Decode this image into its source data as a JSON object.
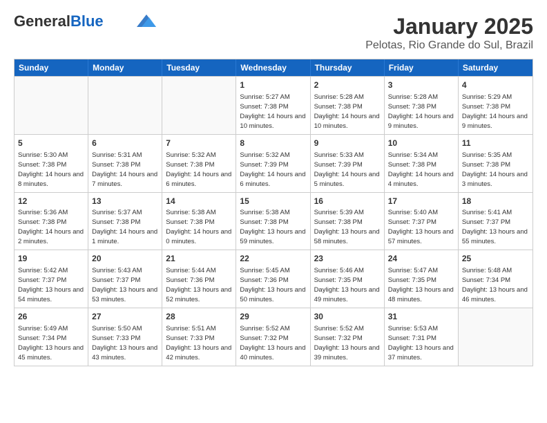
{
  "header": {
    "logo_general": "General",
    "logo_blue": "Blue",
    "title": "January 2025",
    "subtitle": "Pelotas, Rio Grande do Sul, Brazil"
  },
  "calendar": {
    "days_of_week": [
      "Sunday",
      "Monday",
      "Tuesday",
      "Wednesday",
      "Thursday",
      "Friday",
      "Saturday"
    ],
    "rows": [
      [
        {
          "day": "",
          "sunrise": "",
          "sunset": "",
          "daylight": "",
          "empty": true
        },
        {
          "day": "",
          "sunrise": "",
          "sunset": "",
          "daylight": "",
          "empty": true
        },
        {
          "day": "",
          "sunrise": "",
          "sunset": "",
          "daylight": "",
          "empty": true
        },
        {
          "day": "1",
          "sunrise": "Sunrise: 5:27 AM",
          "sunset": "Sunset: 7:38 PM",
          "daylight": "Daylight: 14 hours and 10 minutes."
        },
        {
          "day": "2",
          "sunrise": "Sunrise: 5:28 AM",
          "sunset": "Sunset: 7:38 PM",
          "daylight": "Daylight: 14 hours and 10 minutes."
        },
        {
          "day": "3",
          "sunrise": "Sunrise: 5:28 AM",
          "sunset": "Sunset: 7:38 PM",
          "daylight": "Daylight: 14 hours and 9 minutes."
        },
        {
          "day": "4",
          "sunrise": "Sunrise: 5:29 AM",
          "sunset": "Sunset: 7:38 PM",
          "daylight": "Daylight: 14 hours and 9 minutes."
        }
      ],
      [
        {
          "day": "5",
          "sunrise": "Sunrise: 5:30 AM",
          "sunset": "Sunset: 7:38 PM",
          "daylight": "Daylight: 14 hours and 8 minutes."
        },
        {
          "day": "6",
          "sunrise": "Sunrise: 5:31 AM",
          "sunset": "Sunset: 7:38 PM",
          "daylight": "Daylight: 14 hours and 7 minutes."
        },
        {
          "day": "7",
          "sunrise": "Sunrise: 5:32 AM",
          "sunset": "Sunset: 7:38 PM",
          "daylight": "Daylight: 14 hours and 6 minutes."
        },
        {
          "day": "8",
          "sunrise": "Sunrise: 5:32 AM",
          "sunset": "Sunset: 7:39 PM",
          "daylight": "Daylight: 14 hours and 6 minutes."
        },
        {
          "day": "9",
          "sunrise": "Sunrise: 5:33 AM",
          "sunset": "Sunset: 7:39 PM",
          "daylight": "Daylight: 14 hours and 5 minutes."
        },
        {
          "day": "10",
          "sunrise": "Sunrise: 5:34 AM",
          "sunset": "Sunset: 7:38 PM",
          "daylight": "Daylight: 14 hours and 4 minutes."
        },
        {
          "day": "11",
          "sunrise": "Sunrise: 5:35 AM",
          "sunset": "Sunset: 7:38 PM",
          "daylight": "Daylight: 14 hours and 3 minutes."
        }
      ],
      [
        {
          "day": "12",
          "sunrise": "Sunrise: 5:36 AM",
          "sunset": "Sunset: 7:38 PM",
          "daylight": "Daylight: 14 hours and 2 minutes."
        },
        {
          "day": "13",
          "sunrise": "Sunrise: 5:37 AM",
          "sunset": "Sunset: 7:38 PM",
          "daylight": "Daylight: 14 hours and 1 minute."
        },
        {
          "day": "14",
          "sunrise": "Sunrise: 5:38 AM",
          "sunset": "Sunset: 7:38 PM",
          "daylight": "Daylight: 14 hours and 0 minutes."
        },
        {
          "day": "15",
          "sunrise": "Sunrise: 5:38 AM",
          "sunset": "Sunset: 7:38 PM",
          "daylight": "Daylight: 13 hours and 59 minutes."
        },
        {
          "day": "16",
          "sunrise": "Sunrise: 5:39 AM",
          "sunset": "Sunset: 7:38 PM",
          "daylight": "Daylight: 13 hours and 58 minutes."
        },
        {
          "day": "17",
          "sunrise": "Sunrise: 5:40 AM",
          "sunset": "Sunset: 7:37 PM",
          "daylight": "Daylight: 13 hours and 57 minutes."
        },
        {
          "day": "18",
          "sunrise": "Sunrise: 5:41 AM",
          "sunset": "Sunset: 7:37 PM",
          "daylight": "Daylight: 13 hours and 55 minutes."
        }
      ],
      [
        {
          "day": "19",
          "sunrise": "Sunrise: 5:42 AM",
          "sunset": "Sunset: 7:37 PM",
          "daylight": "Daylight: 13 hours and 54 minutes."
        },
        {
          "day": "20",
          "sunrise": "Sunrise: 5:43 AM",
          "sunset": "Sunset: 7:37 PM",
          "daylight": "Daylight: 13 hours and 53 minutes."
        },
        {
          "day": "21",
          "sunrise": "Sunrise: 5:44 AM",
          "sunset": "Sunset: 7:36 PM",
          "daylight": "Daylight: 13 hours and 52 minutes."
        },
        {
          "day": "22",
          "sunrise": "Sunrise: 5:45 AM",
          "sunset": "Sunset: 7:36 PM",
          "daylight": "Daylight: 13 hours and 50 minutes."
        },
        {
          "day": "23",
          "sunrise": "Sunrise: 5:46 AM",
          "sunset": "Sunset: 7:35 PM",
          "daylight": "Daylight: 13 hours and 49 minutes."
        },
        {
          "day": "24",
          "sunrise": "Sunrise: 5:47 AM",
          "sunset": "Sunset: 7:35 PM",
          "daylight": "Daylight: 13 hours and 48 minutes."
        },
        {
          "day": "25",
          "sunrise": "Sunrise: 5:48 AM",
          "sunset": "Sunset: 7:34 PM",
          "daylight": "Daylight: 13 hours and 46 minutes."
        }
      ],
      [
        {
          "day": "26",
          "sunrise": "Sunrise: 5:49 AM",
          "sunset": "Sunset: 7:34 PM",
          "daylight": "Daylight: 13 hours and 45 minutes."
        },
        {
          "day": "27",
          "sunrise": "Sunrise: 5:50 AM",
          "sunset": "Sunset: 7:33 PM",
          "daylight": "Daylight: 13 hours and 43 minutes."
        },
        {
          "day": "28",
          "sunrise": "Sunrise: 5:51 AM",
          "sunset": "Sunset: 7:33 PM",
          "daylight": "Daylight: 13 hours and 42 minutes."
        },
        {
          "day": "29",
          "sunrise": "Sunrise: 5:52 AM",
          "sunset": "Sunset: 7:32 PM",
          "daylight": "Daylight: 13 hours and 40 minutes."
        },
        {
          "day": "30",
          "sunrise": "Sunrise: 5:52 AM",
          "sunset": "Sunset: 7:32 PM",
          "daylight": "Daylight: 13 hours and 39 minutes."
        },
        {
          "day": "31",
          "sunrise": "Sunrise: 5:53 AM",
          "sunset": "Sunset: 7:31 PM",
          "daylight": "Daylight: 13 hours and 37 minutes."
        },
        {
          "day": "",
          "sunrise": "",
          "sunset": "",
          "daylight": "",
          "empty": true
        }
      ]
    ]
  }
}
